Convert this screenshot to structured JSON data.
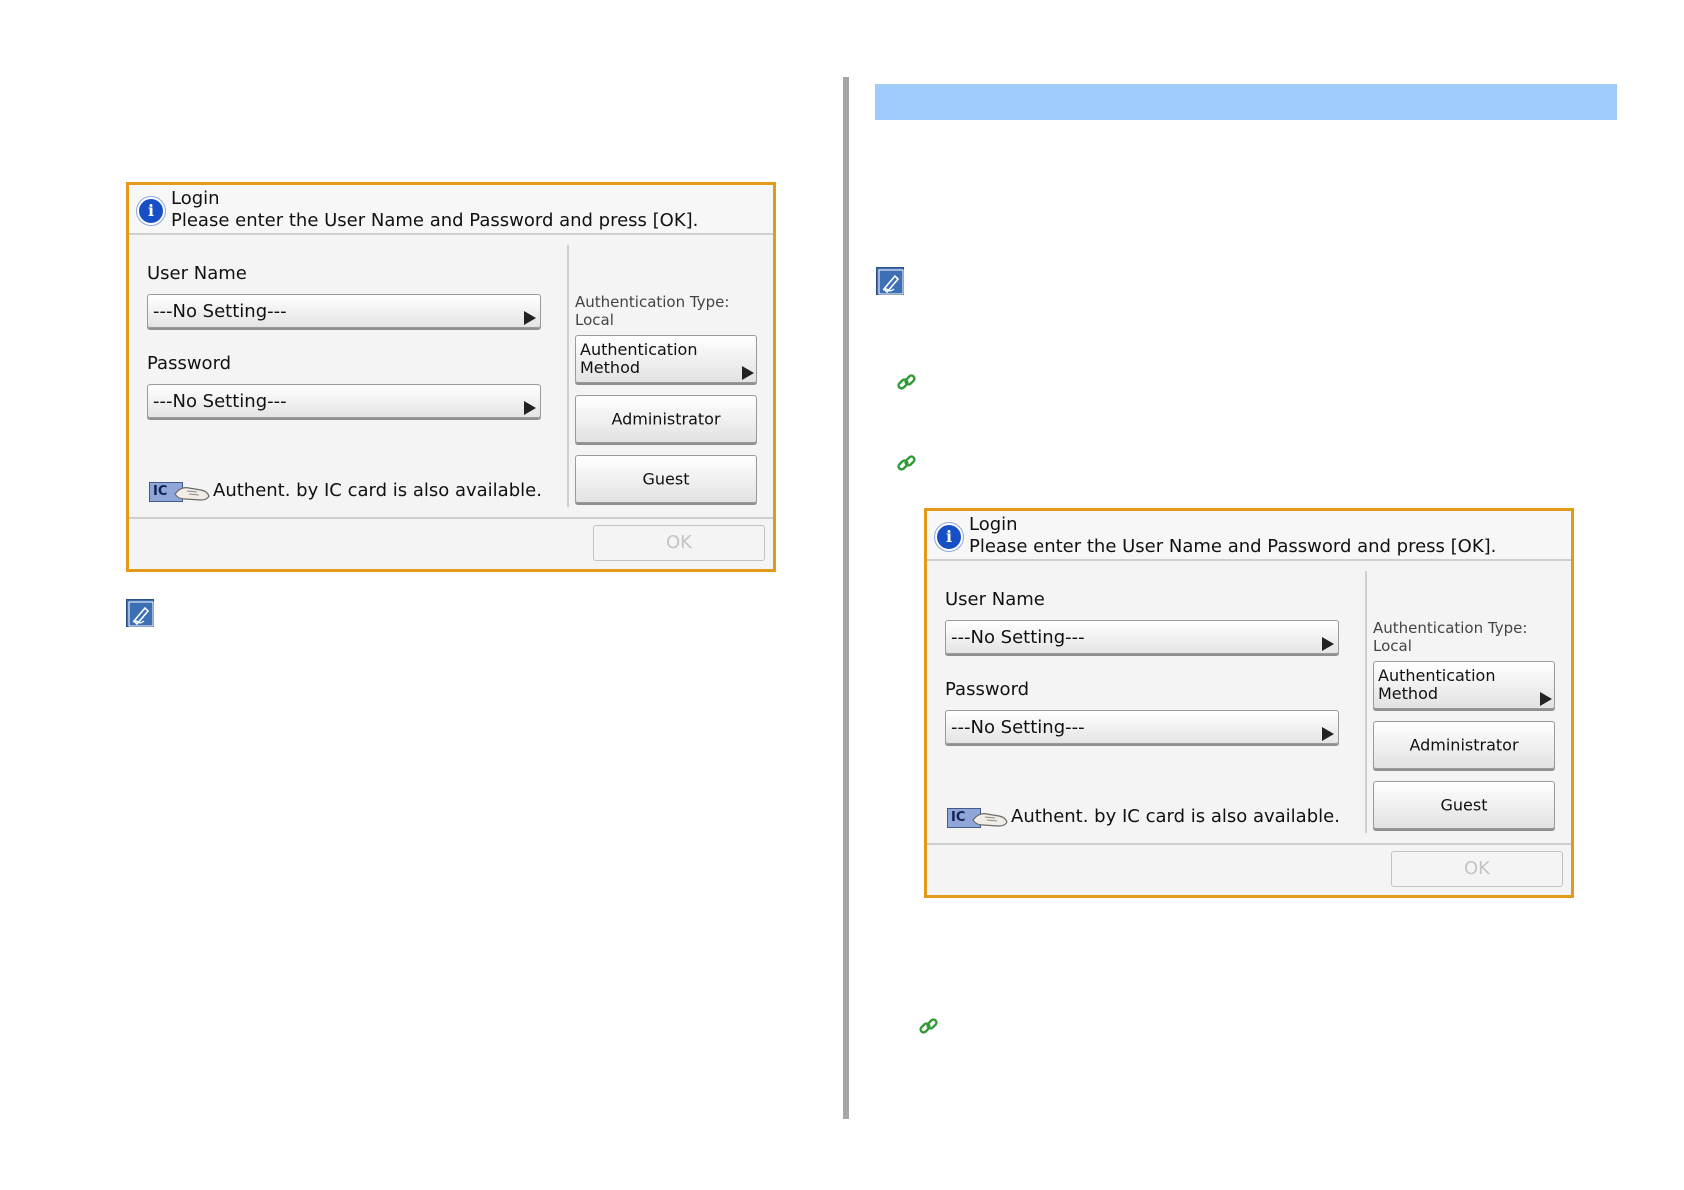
{
  "colors": {
    "panel_border": "#e49a19",
    "section_bar": "#9ecbfa",
    "info_icon": "#1750c6",
    "link_icon": "#2e9a36",
    "memo_icon": "#3d6fb5"
  },
  "login_panels": [
    {
      "title": "Login",
      "message": "Please enter the User Name and Password and press [OK].",
      "user_name_label": "User Name",
      "user_name_value": "---No Setting---",
      "password_label": "Password",
      "password_value": "---No Setting---",
      "auth_type_label": "Authentication Type:",
      "auth_type_value": "Local",
      "auth_method_line1": "Authentication",
      "auth_method_line2": "Method",
      "administrator_label": "Administrator",
      "guest_label": "Guest",
      "ic_card_badge": "IC",
      "ic_card_text": "Authent. by IC card is also available.",
      "ok_label": "OK"
    },
    {
      "title": "Login",
      "message": "Please enter the User Name and Password and press [OK].",
      "user_name_label": "User Name",
      "user_name_value": "---No Setting---",
      "password_label": "Password",
      "password_value": "---No Setting---",
      "auth_type_label": "Authentication Type:",
      "auth_type_value": "Local",
      "auth_method_line1": "Authentication",
      "auth_method_line2": "Method",
      "administrator_label": "Administrator",
      "guest_label": "Guest",
      "ic_card_badge": "IC",
      "ic_card_text": "Authent. by IC card is also available.",
      "ok_label": "OK"
    }
  ]
}
